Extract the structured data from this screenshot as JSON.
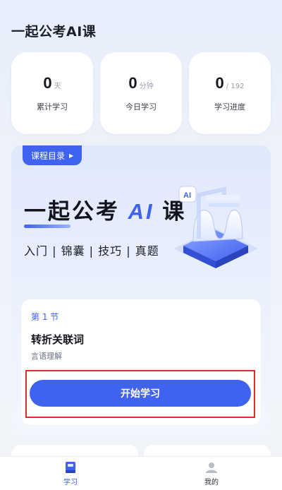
{
  "header": {
    "title": "一起公考AI课"
  },
  "stats": [
    {
      "value": "0",
      "unit": "天",
      "label": "累计学习"
    },
    {
      "value": "0",
      "unit": "分钟",
      "label": "今日学习"
    },
    {
      "value": "0",
      "unit": "/ 192",
      "label": "学习进度"
    }
  ],
  "course": {
    "catalog_label": "课程目录",
    "banner_title_pre": "一起公考",
    "banner_title_ai": "AI",
    "banner_title_post": "课",
    "banner_subtitle": "入门 | 锦囊 | 技巧 | 真题",
    "illustration_badge": "AI",
    "lesson": {
      "section": "第 1 节",
      "title": "转折关联词",
      "subtitle": "言语理解",
      "start_label": "开始学习"
    }
  },
  "tabs": [
    {
      "label": "学习",
      "icon": "book-icon",
      "active": true
    },
    {
      "label": "我的",
      "icon": "user-icon",
      "active": false
    }
  ],
  "colors": {
    "accent": "#3f63ef",
    "highlight_outline": "#e02a2a"
  }
}
